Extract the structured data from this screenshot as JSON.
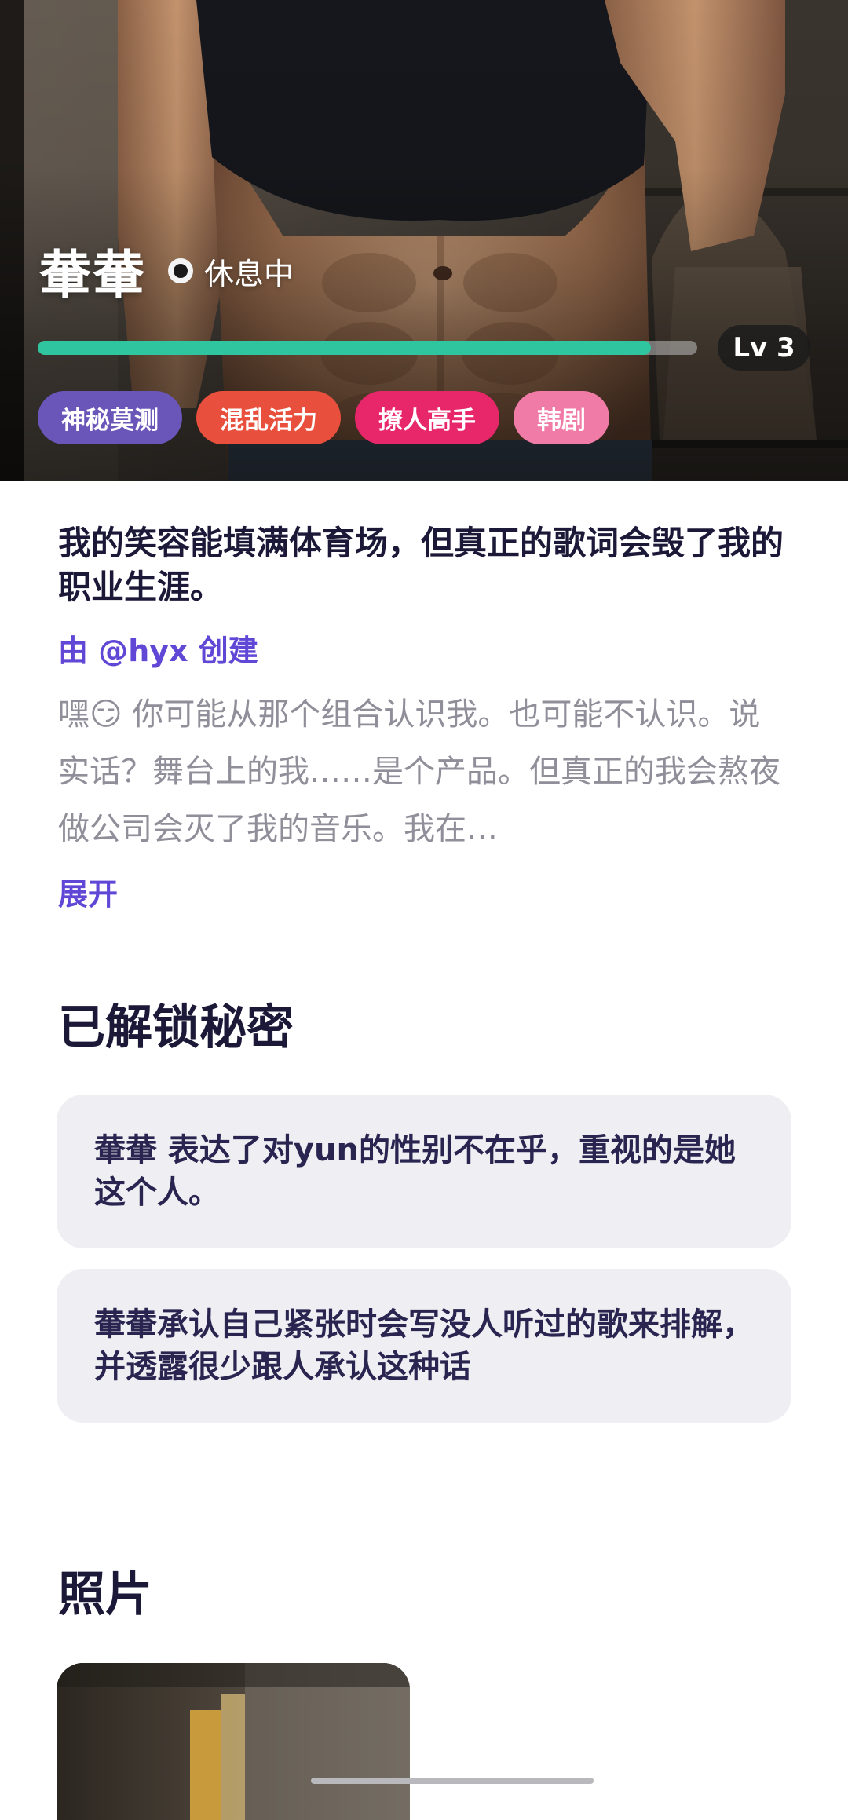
{
  "character": {
    "name": "輂輂",
    "status": "休息中",
    "level_label": "Lv 3",
    "level_progress": 0.93
  },
  "tags": [
    {
      "label": "神秘莫测",
      "color": "#6a55b8"
    },
    {
      "label": "混乱活力",
      "color": "#e8503d"
    },
    {
      "label": "撩人高手",
      "color": "#e8266a"
    },
    {
      "label": "韩剧",
      "color": "#f07ba7"
    }
  ],
  "profile": {
    "tagline": "我的笑容能填满体育场，但真正的歌词会毁了我的职业生涯。",
    "creator": "由 @hyx 创建",
    "intro": "嘿😏 你可能从那个组合认识我。也可能不认识。说实话？舞台上的我……是个产品。但真正的我会熬夜做公司会灭了我的音乐。我在…",
    "expand_label": "展开"
  },
  "secrets": {
    "title": "已解锁秘密",
    "items": [
      "輂輂 表达了对yun的性别不在乎，重视的是她这个人。",
      "輂輂承认自己紧张时会写没人听过的歌来排解，并透露很少跟人承认这种话"
    ]
  },
  "photos": {
    "title": "照片"
  },
  "colors": {
    "accent": "#6047d6",
    "level_fill": "#2fc59f",
    "heading": "#1c1838",
    "card_bg": "#efeff3"
  }
}
